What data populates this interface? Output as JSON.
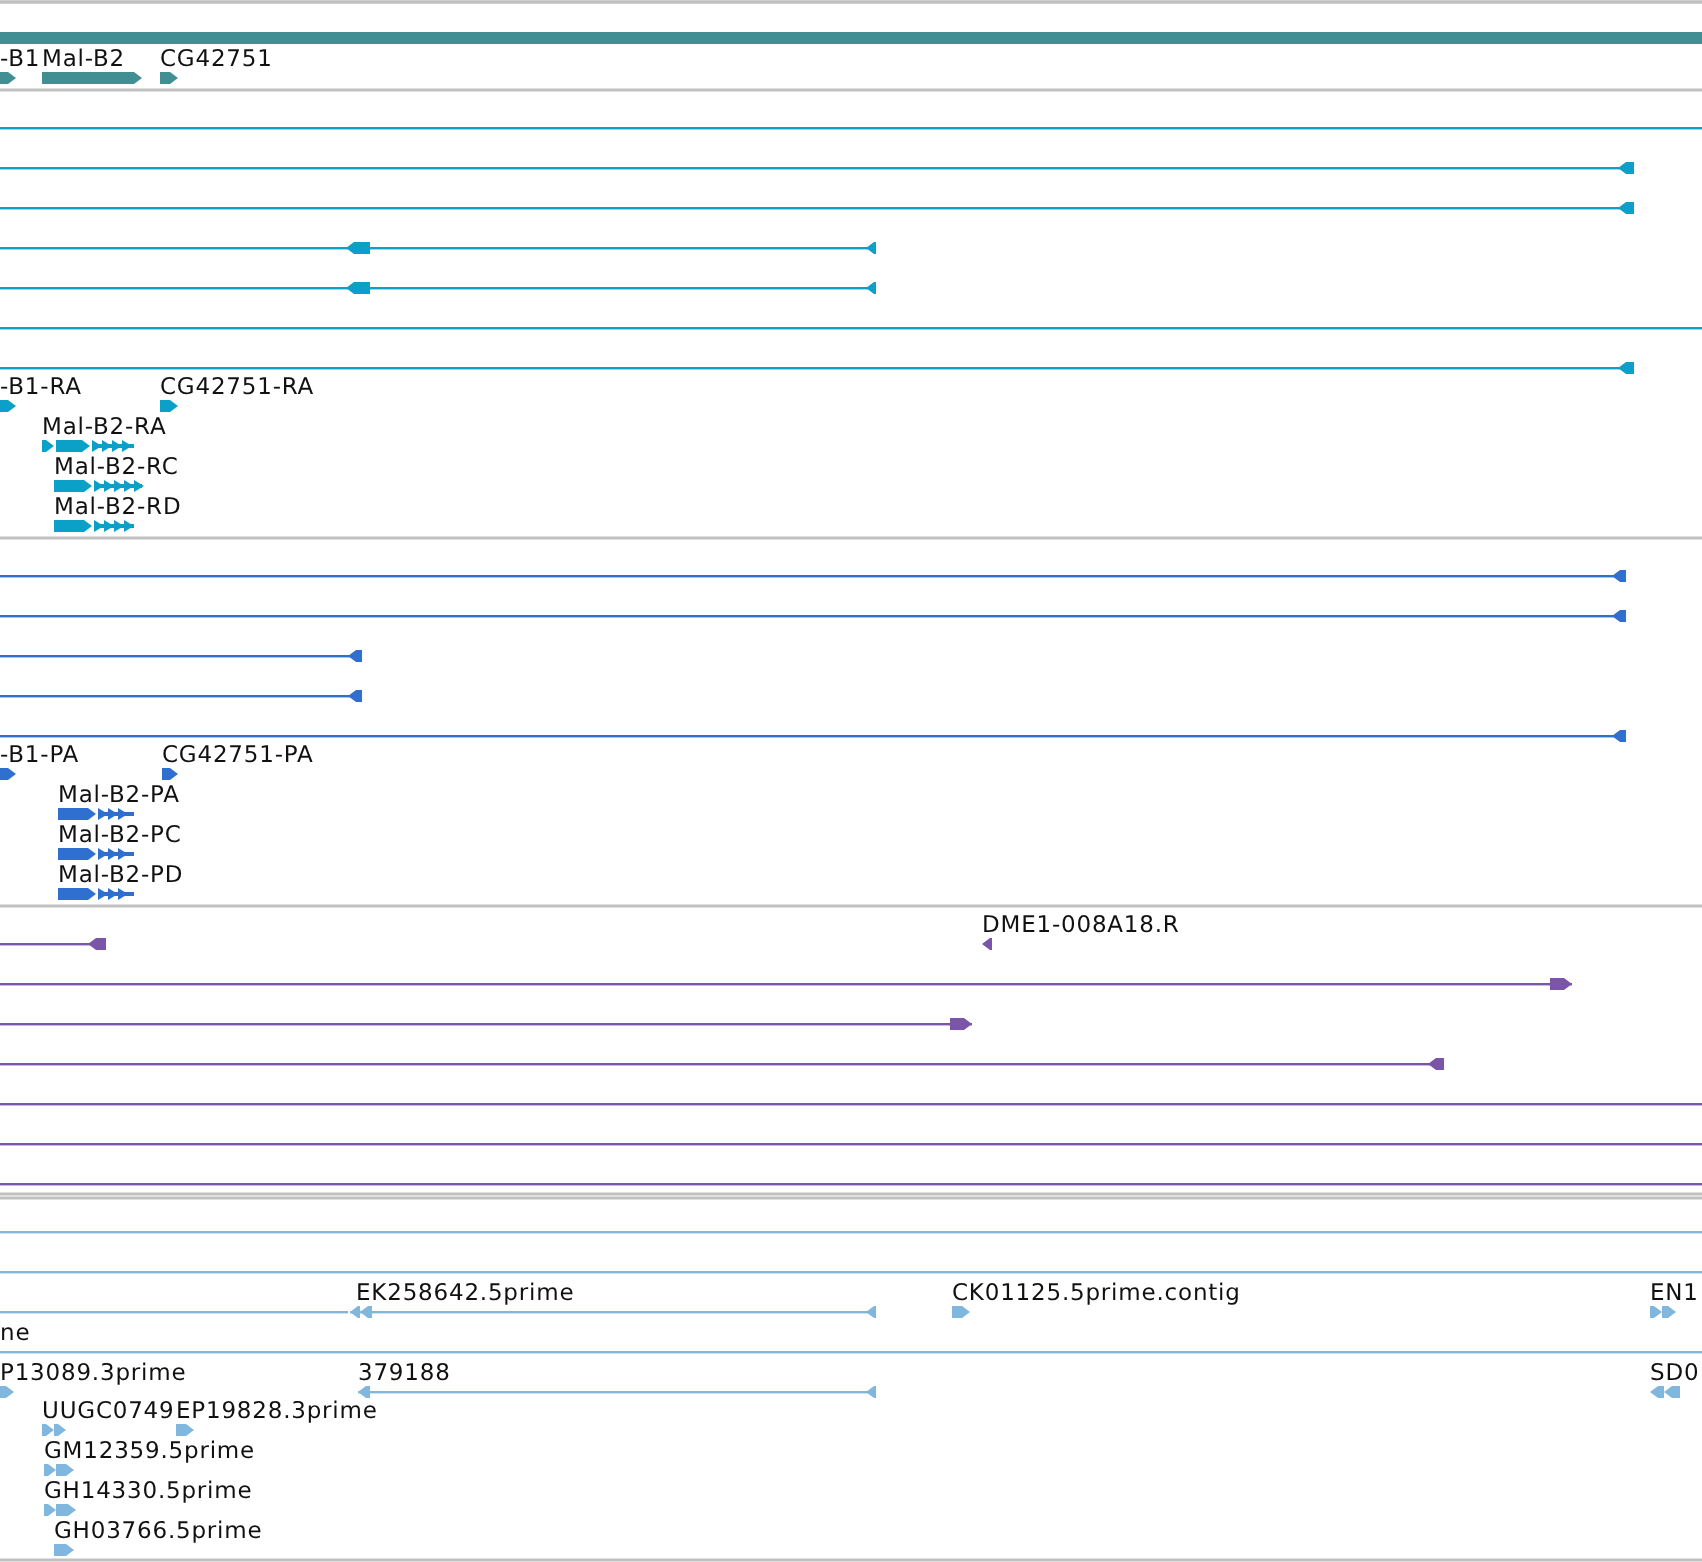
{
  "tracks": [
    {
      "kind": "gene",
      "color": "#418f93",
      "features": [
        {
          "kind": "bar"
        },
        {
          "kind": "glyph",
          "label": "-B1",
          "reverse": false
        },
        {
          "kind": "glyph",
          "label": "Mal-B2",
          "reverse": false
        },
        {
          "kind": "glyph",
          "label": "CG42751",
          "reverse": false
        }
      ]
    },
    {
      "kind": "transcript",
      "color": "#0aa0c8",
      "features": [
        {
          "kind": "line"
        },
        {
          "kind": "span",
          "reverse": true
        },
        {
          "kind": "span",
          "reverse": true
        },
        {
          "kind": "span",
          "reverse": true
        },
        {
          "kind": "span",
          "reverse": true
        },
        {
          "kind": "line"
        },
        {
          "kind": "span",
          "reverse": true
        },
        {
          "kind": "glyph",
          "label": "-B1-RA",
          "reverse": false
        },
        {
          "kind": "glyph",
          "label": "CG42751-RA",
          "reverse": false
        },
        {
          "kind": "glyph",
          "label": "Mal-B2-RA",
          "reverse": false
        },
        {
          "kind": "glyph",
          "label": "Mal-B2-RC",
          "reverse": false
        },
        {
          "kind": "glyph",
          "label": "Mal-B2-RD",
          "reverse": false
        }
      ]
    },
    {
      "kind": "protein",
      "color": "#2f6fd0",
      "features": [
        {
          "kind": "span",
          "reverse": true
        },
        {
          "kind": "span",
          "reverse": true
        },
        {
          "kind": "span",
          "reverse": true
        },
        {
          "kind": "span",
          "reverse": true
        },
        {
          "kind": "span",
          "reverse": true
        },
        {
          "kind": "glyph",
          "label": "-B1-PA",
          "reverse": false
        },
        {
          "kind": "glyph",
          "label": "CG42751-PA",
          "reverse": false
        },
        {
          "kind": "glyph",
          "label": "Mal-B2-PA",
          "reverse": false
        },
        {
          "kind": "glyph",
          "label": "Mal-B2-PC",
          "reverse": false
        },
        {
          "kind": "glyph",
          "label": "Mal-B2-PD",
          "reverse": false
        }
      ]
    },
    {
      "kind": "alignment",
      "color": "#7a55aa",
      "features": [
        {
          "kind": "span",
          "reverse": true
        },
        {
          "kind": "glyph",
          "label": "DME1-008A18.R",
          "reverse": true
        },
        {
          "kind": "span",
          "reverse": false
        },
        {
          "kind": "span",
          "reverse": false
        },
        {
          "kind": "span",
          "reverse": true
        },
        {
          "kind": "line"
        },
        {
          "kind": "line"
        },
        {
          "kind": "line"
        }
      ]
    },
    {
      "kind": "est",
      "color": "#80b7de",
      "features": [
        {
          "kind": "line"
        },
        {
          "kind": "line"
        },
        {
          "kind": "line"
        },
        {
          "kind": "span",
          "label": "EK258642.5prime",
          "reverse": true
        },
        {
          "kind": "glyph",
          "label": "CK01125.5prime.contig",
          "reverse": false
        },
        {
          "kind": "glyph",
          "label": "EN1",
          "reverse": false
        },
        {
          "kind": "line",
          "label": "ne"
        },
        {
          "kind": "glyph",
          "label": "P13089.3prime",
          "reverse": false
        },
        {
          "kind": "span",
          "label": "379188",
          "reverse": true
        },
        {
          "kind": "glyph",
          "label": "SD0",
          "reverse": true
        },
        {
          "kind": "glyph",
          "label": "UUGC0749",
          "reverse": false
        },
        {
          "kind": "glyph",
          "label": "EP19828.3prime",
          "reverse": false
        },
        {
          "kind": "glyph",
          "label": "GM12359.5prime",
          "reverse": false
        },
        {
          "kind": "glyph",
          "label": "GH14330.5prime",
          "reverse": false
        },
        {
          "kind": "glyph",
          "label": "GH03766.5prime",
          "reverse": false
        }
      ]
    }
  ]
}
